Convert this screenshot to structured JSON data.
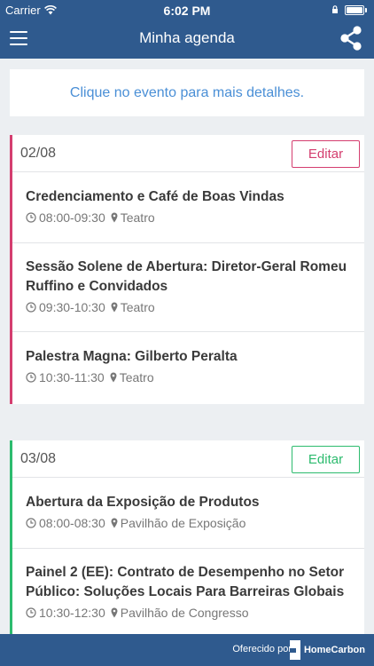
{
  "status_bar": {
    "carrier": "Carrier",
    "time": "6:02 PM",
    "battery_level": 1.0
  },
  "navbar": {
    "title": "Minha agenda",
    "menu_icon": "hamburger-menu-icon",
    "share_icon": "share-icon"
  },
  "hint": {
    "text": "Clique no evento para mais detalhes."
  },
  "days": [
    {
      "date": "02/08",
      "edit_label": "Editar",
      "color": "#d43e6f",
      "events": [
        {
          "title": "Credenciamento e Café de Boas Vindas",
          "time": "08:00-09:30",
          "location": "Teatro"
        },
        {
          "title": "Sessão Solene de Abertura: Diretor-Geral Romeu Ruffino e Convidados",
          "time": "09:30-10:30",
          "location": "Teatro"
        },
        {
          "title": "Palestra Magna: Gilberto Peralta",
          "time": "10:30-11:30",
          "location": "Teatro"
        }
      ]
    },
    {
      "date": "03/08",
      "edit_label": "Editar",
      "color": "#2dbb6e",
      "events": [
        {
          "title": "Abertura da Exposição de Produtos",
          "time": "08:00-08:30",
          "location": "Pavilhão de Exposição"
        },
        {
          "title": "Painel 2 (EE): Contrato de Desempenho no Setor Público: Soluções Locais Para Barreiras Globais",
          "time": "10:30-12:30",
          "location": "Pavilhão de Congresso"
        }
      ]
    }
  ],
  "footer": {
    "label": "Oferecido por",
    "brand": "HomeCarbon",
    "brand_color": "#2f5a8e"
  }
}
